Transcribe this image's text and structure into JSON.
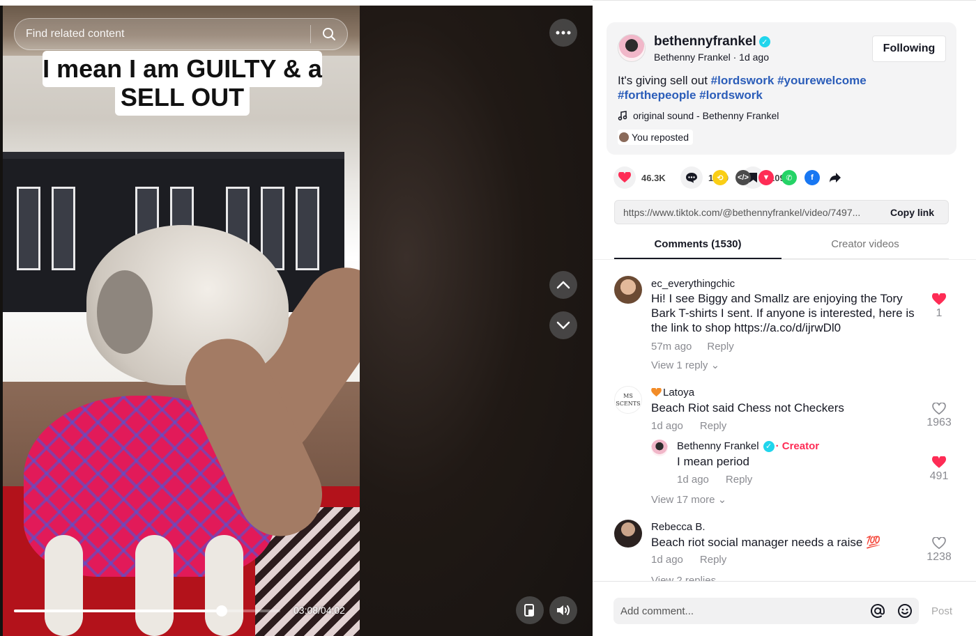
{
  "video": {
    "search_placeholder": "Find related content",
    "caption_line1": "I mean I am GUILTY & a",
    "caption_line2": "SELL OUT",
    "time": "03:08/04:02",
    "progress": 0.78
  },
  "post": {
    "username": "bethennyfrankel",
    "subline": "Bethenny Frankel · 1d ago",
    "follow_label": "Following",
    "caption_plain": "It's giving sell out ",
    "hashtags": [
      "#lordswork",
      "#yourewelcome",
      "#forthepeople",
      "#lordswork"
    ],
    "sound": "original sound - Bethenny Frankel",
    "repost_label": "You reposted"
  },
  "stats": {
    "likes": "46.3K",
    "comments": "1530",
    "saves": "1094"
  },
  "share_icons": [
    {
      "name": "repost-icon",
      "color": "#FACE15",
      "glyph": "⟲"
    },
    {
      "name": "embed-icon",
      "color": "#4b4b4b",
      "glyph": "</>"
    },
    {
      "name": "send-icon",
      "color": "#FE2C55",
      "glyph": "▼"
    },
    {
      "name": "whatsapp-icon",
      "color": "#25D366",
      "glyph": "✆"
    },
    {
      "name": "facebook-icon",
      "color": "#1877F2",
      "glyph": "f"
    }
  ],
  "link": {
    "url": "https://www.tiktok.com/@bethennyfrankel/video/7497...",
    "copy_label": "Copy link"
  },
  "tabs": {
    "comments": "Comments (1530)",
    "creator": "Creator videos"
  },
  "comments": [
    {
      "user": "ec_everythingchic",
      "text": "Hi! I see Biggy and Smallz are enjoying the Tory Bark T-shirts I sent. If anyone is interested, here is the link to shop https://a.co/d/ijrwDl0",
      "time": "57m ago",
      "reply": "Reply",
      "view": "View 1 reply ⌄",
      "likes": "1",
      "liked": true
    },
    {
      "user": "Latoya",
      "text": "Beach Riot said Chess not Checkers",
      "time": "1d ago",
      "reply": "Reply",
      "likes": "1963",
      "liked": false,
      "avatar_text": "MS SCENTS",
      "replies": [
        {
          "user": "Bethenny Frankel",
          "creator_tag": "· Creator",
          "text": "I mean period",
          "time": "1d ago",
          "reply": "Reply",
          "likes": "491",
          "liked": true
        }
      ],
      "view": "View 17 more ⌄"
    },
    {
      "user": "Rebecca B.",
      "text": "Beach riot social manager needs a raise 💯",
      "time": "1d ago",
      "reply": "Reply",
      "view": "View 2 replies ⌄",
      "likes": "1238",
      "liked": false
    }
  ],
  "composer": {
    "placeholder": "Add comment...",
    "post_label": "Post"
  },
  "colors": {
    "accent": "#FE2C55",
    "hashtag": "#2B5DB9",
    "creator": "#FE2C55"
  }
}
